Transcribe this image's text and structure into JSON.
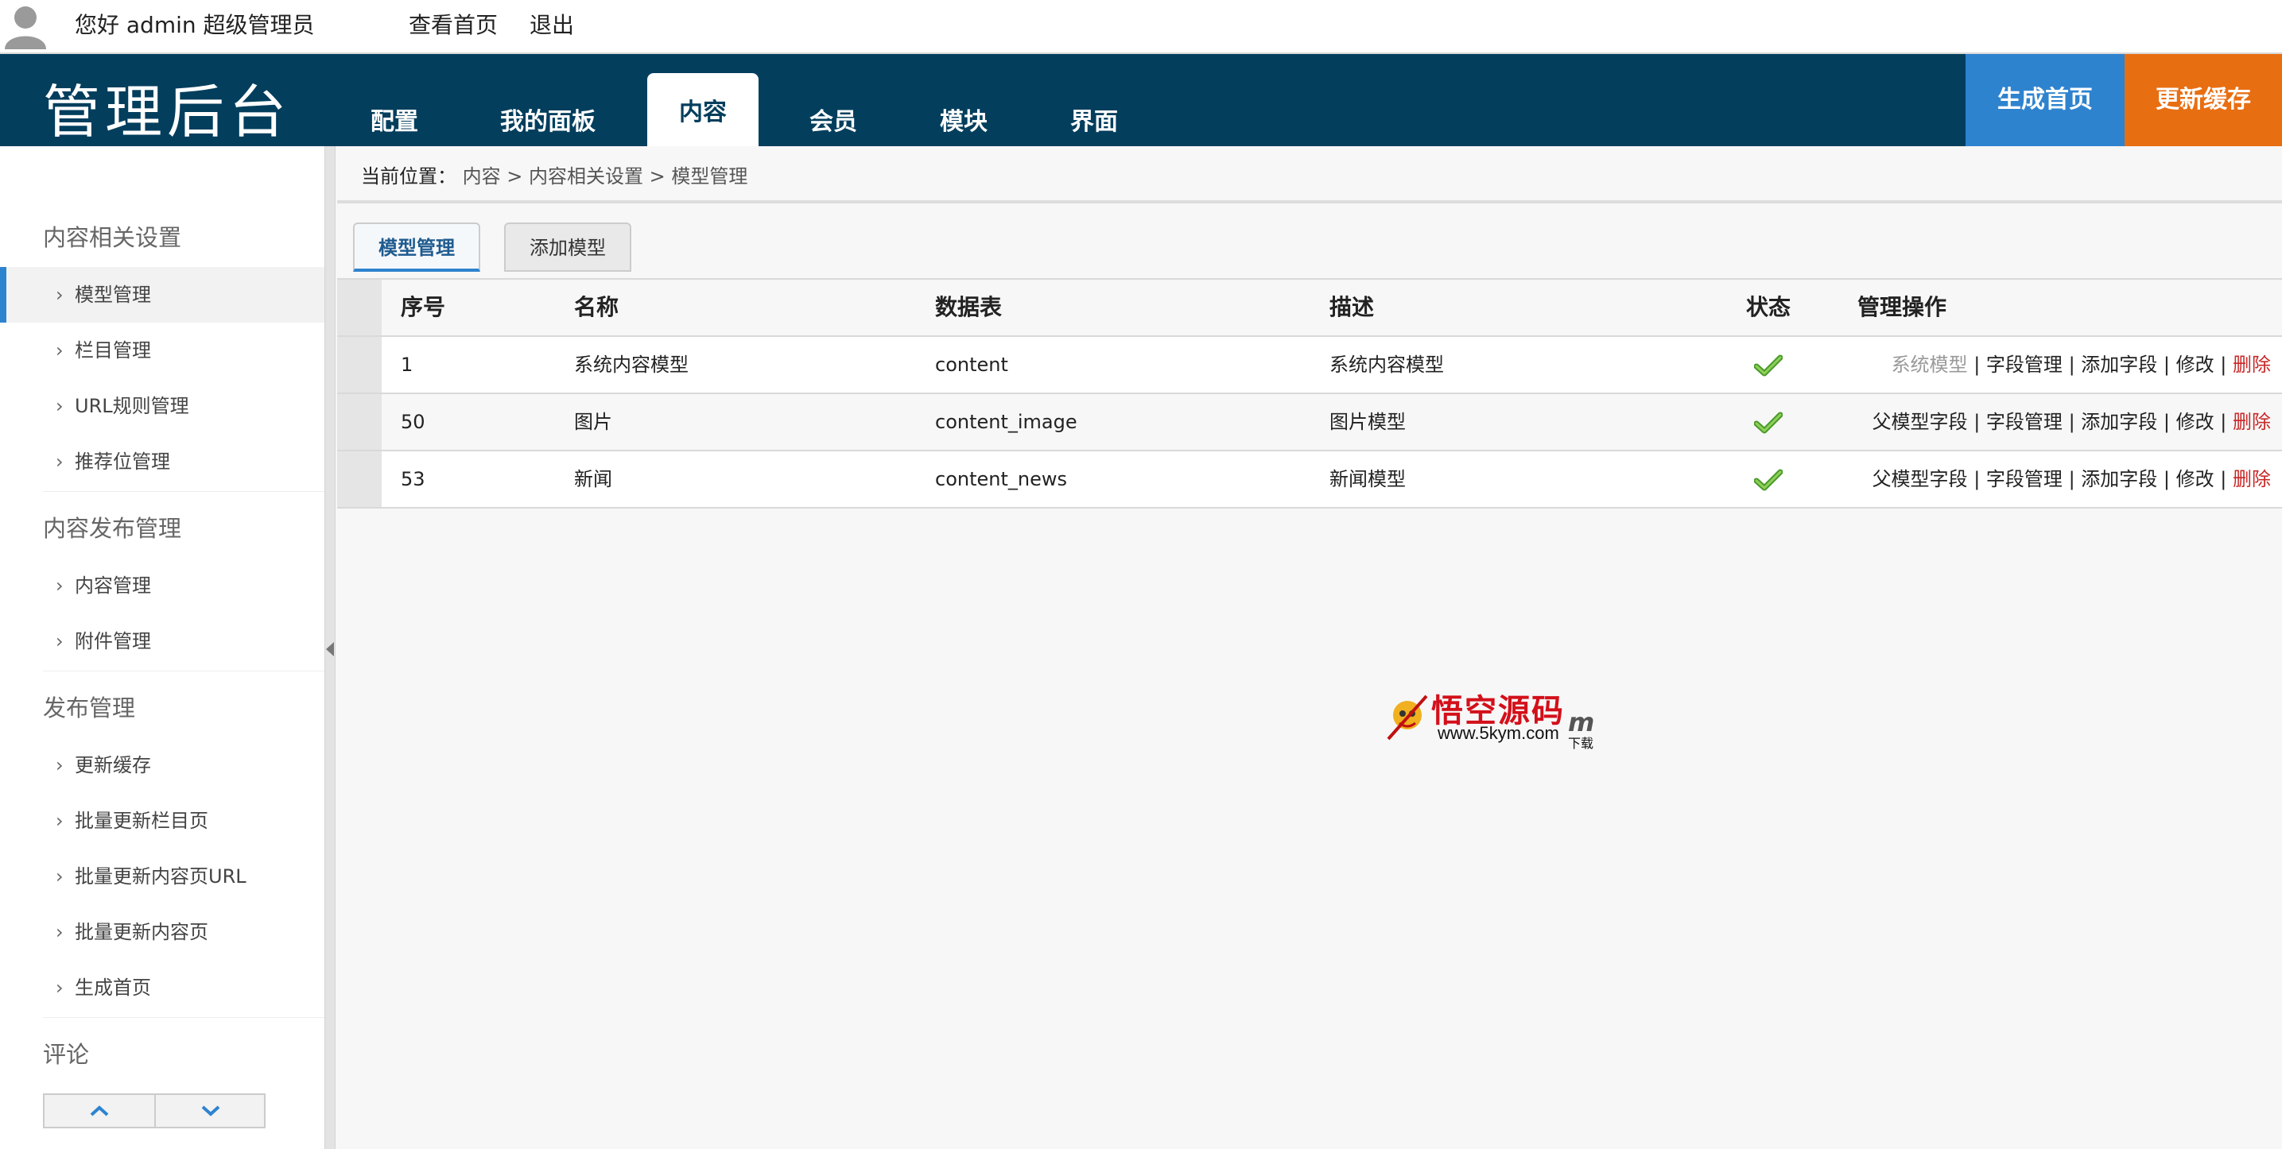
{
  "userbar": {
    "greeting": "您好 admin 超级管理员",
    "home_link": "查看首页",
    "logout_link": "退出"
  },
  "header": {
    "logo": "管理后台",
    "nav": [
      {
        "label": "配置",
        "active": false
      },
      {
        "label": "我的面板",
        "active": false
      },
      {
        "label": "内容",
        "active": true
      },
      {
        "label": "会员",
        "active": false
      },
      {
        "label": "模块",
        "active": false
      },
      {
        "label": "界面",
        "active": false
      }
    ],
    "gen_home_btn": "生成首页",
    "update_cache_btn": "更新缓存",
    "colors": {
      "bar": "#033e5d",
      "blue_btn": "#2e83cf",
      "orange_btn": "#e86e12"
    }
  },
  "sidebar": {
    "sections": [
      {
        "title": "内容相关设置",
        "items": [
          "模型管理",
          "栏目管理",
          "URL规则管理",
          "推荐位管理"
        ]
      },
      {
        "title": "内容发布管理",
        "items": [
          "内容管理",
          "附件管理"
        ]
      },
      {
        "title": "发布管理",
        "items": [
          "更新缓存",
          "批量更新栏目页",
          "批量更新内容页URL",
          "批量更新内容页",
          "生成首页"
        ]
      },
      {
        "title": "评论",
        "items": []
      }
    ],
    "active_item": "模型管理",
    "chevron": "›",
    "scroll_up_icon": "chevron-up-icon",
    "scroll_down_icon": "chevron-down-icon"
  },
  "breadcrumb": {
    "prefix": "当前位置：",
    "parts": [
      "内容",
      "内容相关设置",
      "模型管理"
    ],
    "sep": ">"
  },
  "subtabs": [
    {
      "label": "模型管理",
      "active": true
    },
    {
      "label": "添加模型",
      "active": false
    }
  ],
  "table": {
    "headers": [
      "序号",
      "名称",
      "数据表",
      "描述",
      "状态",
      "管理操作"
    ],
    "rows": [
      {
        "id": "1",
        "name": "系统内容模型",
        "table": "content",
        "desc": "系统内容模型",
        "status": "check-icon",
        "ops": [
          {
            "label": "系统模型",
            "style": "disabled"
          },
          {
            "label": "字段管理",
            "style": "normal"
          },
          {
            "label": "添加字段",
            "style": "normal"
          },
          {
            "label": "修改",
            "style": "normal"
          },
          {
            "label": "删除",
            "style": "danger"
          }
        ]
      },
      {
        "id": "50",
        "name": "图片",
        "table": "content_image",
        "desc": "图片模型",
        "status": "check-icon",
        "ops": [
          {
            "label": "父模型字段",
            "style": "normal"
          },
          {
            "label": "字段管理",
            "style": "normal"
          },
          {
            "label": "添加字段",
            "style": "normal"
          },
          {
            "label": "修改",
            "style": "normal"
          },
          {
            "label": "删除",
            "style": "danger"
          }
        ]
      },
      {
        "id": "53",
        "name": "新闻",
        "table": "content_news",
        "desc": "新闻模型",
        "status": "check-icon",
        "ops": [
          {
            "label": "父模型字段",
            "style": "normal"
          },
          {
            "label": "字段管理",
            "style": "normal"
          },
          {
            "label": "添加字段",
            "style": "normal"
          },
          {
            "label": "修改",
            "style": "normal"
          },
          {
            "label": "删除",
            "style": "danger"
          }
        ]
      }
    ],
    "op_sep": "|"
  },
  "watermark": {
    "title": "悟空源码",
    "url": "www.5kym.com",
    "suffix": "下载",
    "mark": "m"
  }
}
